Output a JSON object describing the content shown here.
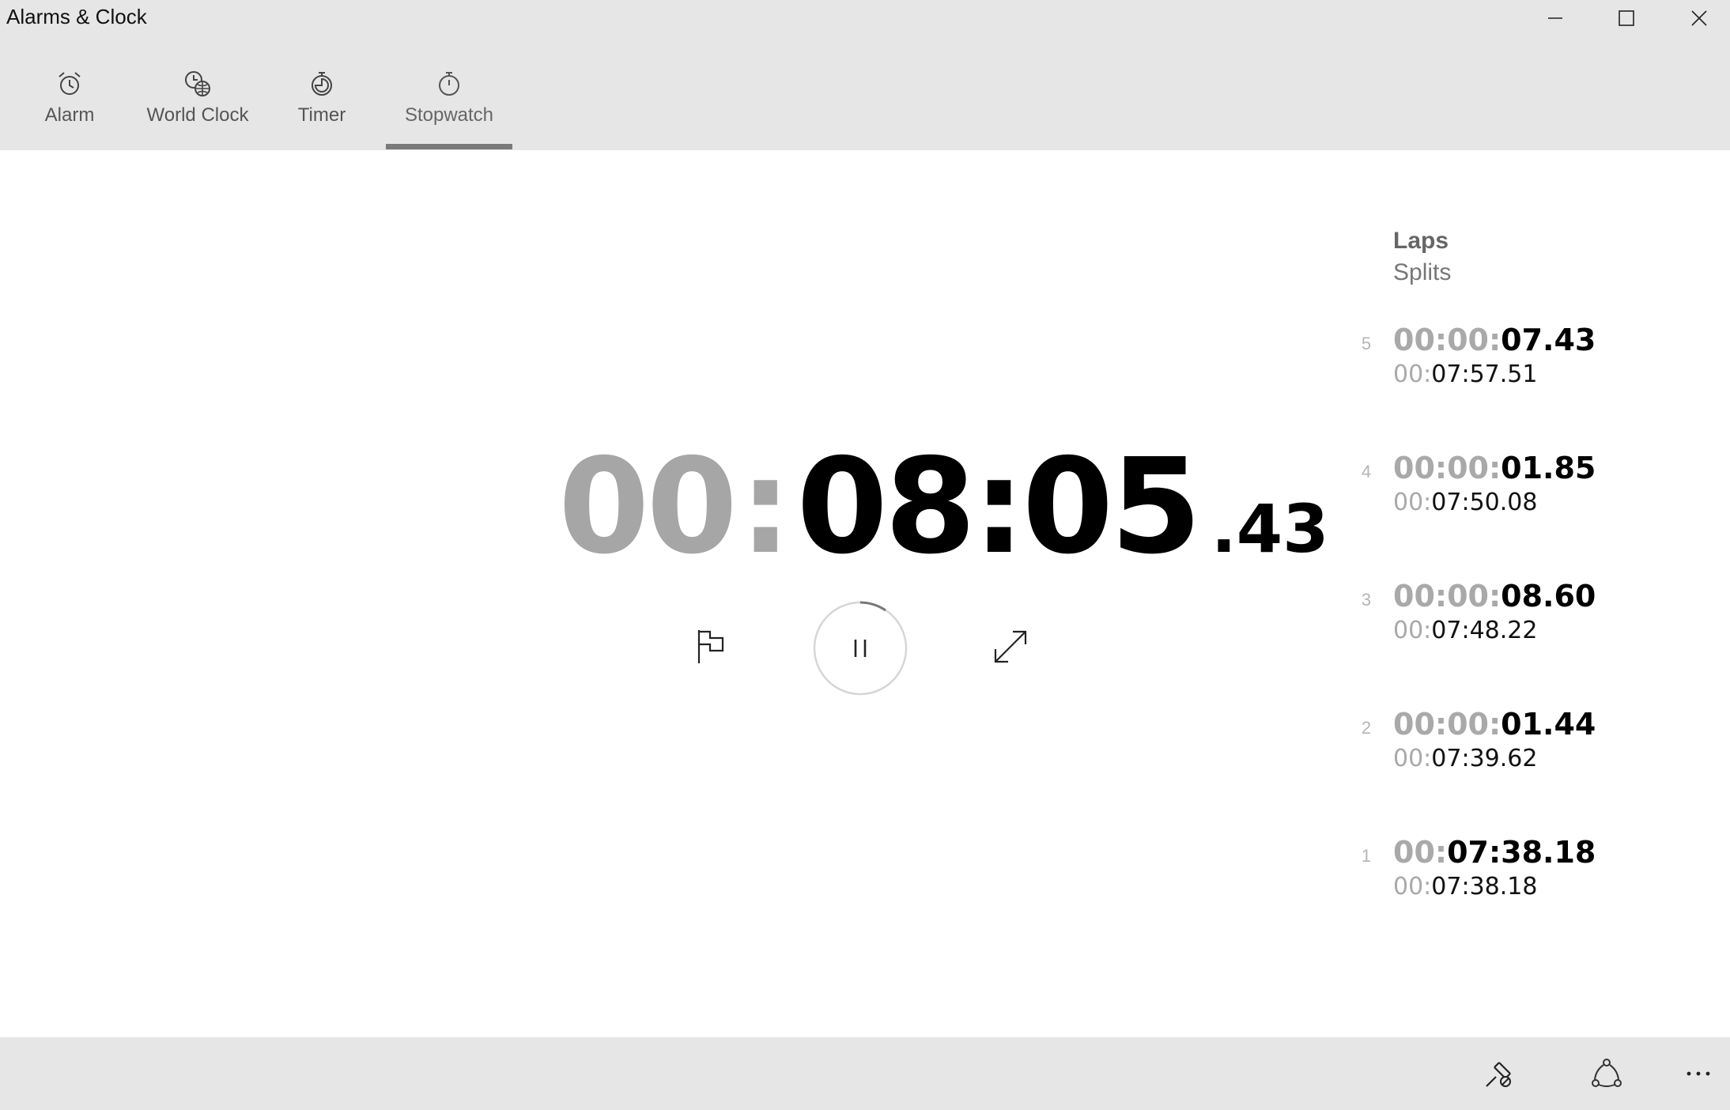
{
  "window": {
    "title": "Alarms & Clock",
    "minimize_icon": "minimize-icon",
    "maximize_icon": "maximize-icon",
    "close_icon": "close-icon"
  },
  "tabs": [
    {
      "label": "Alarm",
      "icon": "alarm-clock-icon",
      "active": false
    },
    {
      "label": "World Clock",
      "icon": "world-clock-icon",
      "active": false
    },
    {
      "label": "Timer",
      "icon": "timer-icon",
      "active": false
    },
    {
      "label": "Stopwatch",
      "icon": "stopwatch-icon",
      "active": true
    }
  ],
  "stopwatch": {
    "hours": "00",
    "separator": ":",
    "minutes_seconds": "08:05",
    "hundredths": ".43",
    "lap_button_icon": "flag-icon",
    "pause_button_icon": "pause-icon",
    "expand_button_icon": "expand-icon"
  },
  "laps": {
    "header": "Laps",
    "subheader": "Splits",
    "items": [
      {
        "num": "5",
        "time_dim": "00:00:",
        "time_bold": "07.43",
        "split_dim": "00:",
        "split_bold": "07:57.51"
      },
      {
        "num": "4",
        "time_dim": "00:00:",
        "time_bold": "01.85",
        "split_dim": "00:",
        "split_bold": "07:50.08"
      },
      {
        "num": "3",
        "time_dim": "00:00:",
        "time_bold": "08.60",
        "split_dim": "00:",
        "split_bold": "07:48.22"
      },
      {
        "num": "2",
        "time_dim": "00:00:",
        "time_bold": "01.44",
        "split_dim": "00:",
        "split_bold": "07:39.62"
      },
      {
        "num": "1",
        "time_dim": "00:",
        "time_bold": "07:38.18",
        "split_dim": "00:",
        "split_bold": "07:38.18"
      }
    ]
  },
  "bottom_bar": {
    "pin_icon": "unpin-icon",
    "share_icon": "share-icon",
    "more_icon": "more-icon",
    "more_label": "..."
  },
  "colors": {
    "chrome": "#e6e6e6",
    "dim_digits": "#a6a6a6",
    "tab_indicator": "#7a7a7a"
  }
}
